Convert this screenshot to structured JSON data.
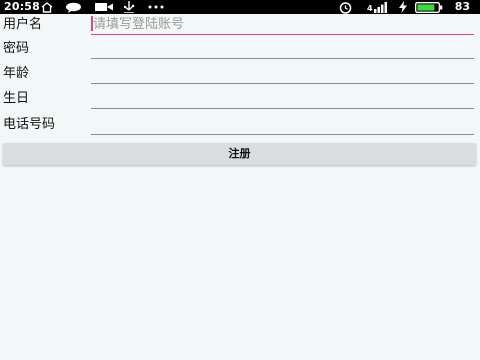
{
  "status_bar": {
    "time": "20:58",
    "battery": "83",
    "icons": [
      "home-icon",
      "message-icon",
      "video-icon",
      "usb-icon",
      "more-icon",
      "alarm-icon",
      "signal-icon",
      "charging-icon",
      "battery-icon"
    ]
  },
  "form": {
    "username_label": "用户名",
    "username_placeholder": "请填写登陆账号",
    "password_label": "密码",
    "age_label": "年龄",
    "birthday_label": "生日",
    "phone_label": "电话号码",
    "register_label": "注册"
  },
  "colors": {
    "accent": "#E0457B",
    "background": "#F2F8F8"
  }
}
